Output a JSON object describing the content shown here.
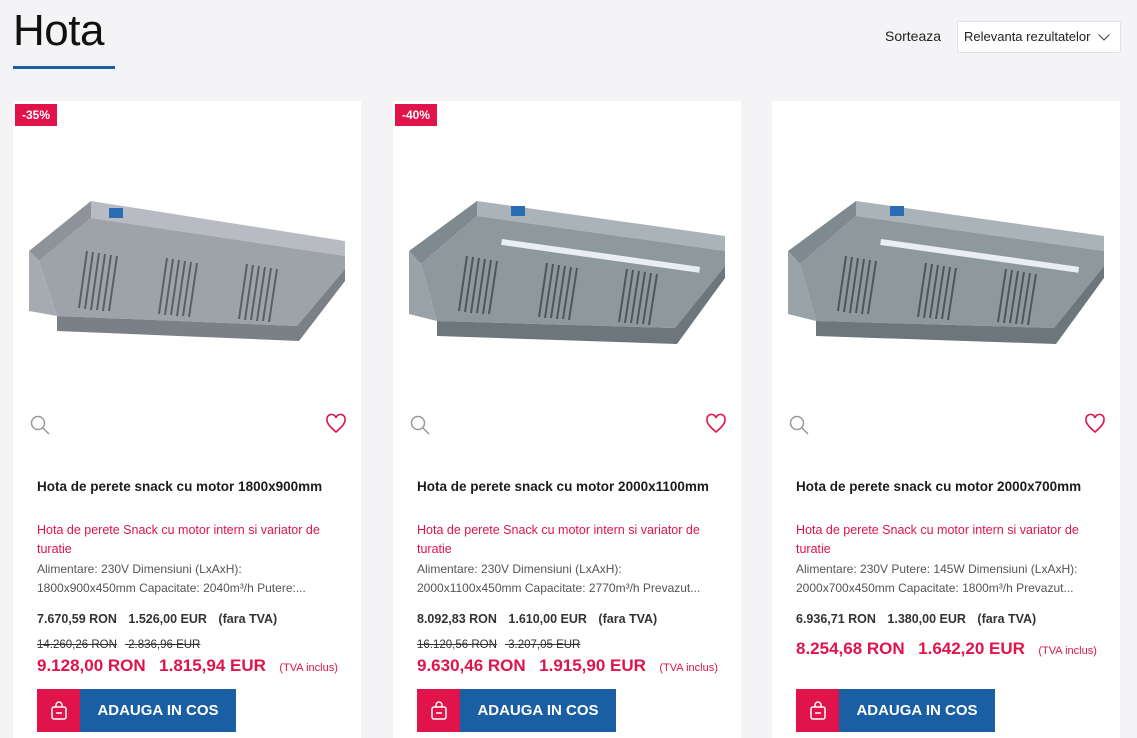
{
  "page": {
    "title": "Hota"
  },
  "sort": {
    "label": "Sorteaza",
    "selected": "Relevanta rezultatelor"
  },
  "colors": {
    "accent": "#e0134b",
    "brand_blue": "#1a5fa3"
  },
  "icons": {
    "zoom": "magnifier-icon",
    "wishlist": "heart-icon",
    "cart": "bag-icon",
    "dropdown": "chevron-down-icon"
  },
  "products": [
    {
      "badge": "-35%",
      "name": "Hota de perete snack cu motor 1800x900mm",
      "subtitle": "Hota de perete Snack cu motor intern si variator de turatie",
      "description": "Alimentare: 230V Dimensiuni (LxAxH): 1800x900x450mm Capacitate: 2040m³/h Putere:...",
      "price_net_ron": "7.670,59 RON",
      "price_net_eur": "1.526,00 EUR",
      "price_net_note": "(fara TVA)",
      "old_price_ron": "14.260,26 RON",
      "old_price_eur": "2.836,96 EUR",
      "price_ron": "9.128,00 RON",
      "price_eur": "1.815,94 EUR",
      "price_note": "(TVA inclus)",
      "cart_label": "ADAUGA IN COS"
    },
    {
      "badge": "-40%",
      "name": "Hota de perete snack cu motor 2000x1100mm",
      "subtitle": "Hota de perete Snack cu motor intern si variator de turatie",
      "description": "Alimentare: 230V Dimensiuni (LxAxH): 2000x1100x450mm Capacitate: 2770m³/h Prevazut...",
      "price_net_ron": "8.092,83 RON",
      "price_net_eur": "1.610,00 EUR",
      "price_net_note": "(fara TVA)",
      "old_price_ron": "16.120,56 RON",
      "old_price_eur": "3.207,05 EUR",
      "price_ron": "9.630,46 RON",
      "price_eur": "1.915,90 EUR",
      "price_note": "(TVA inclus)",
      "cart_label": "ADAUGA IN COS"
    },
    {
      "name": "Hota de perete snack cu motor 2000x700mm",
      "subtitle": "Hota de perete Snack cu motor intern si variator de turatie",
      "description": "Alimentare: 230V Putere: 145W Dimensiuni (LxAxH): 2000x700x450mm Capacitate: 1800m³/h Prevazut...",
      "price_net_ron": "6.936,71 RON",
      "price_net_eur": "1.380,00 EUR",
      "price_net_note": "(fara TVA)",
      "price_ron": "8.254,68 RON",
      "price_eur": "1.642,20 EUR",
      "price_note": "(TVA inclus)",
      "cart_label": "ADAUGA IN COS"
    }
  ]
}
